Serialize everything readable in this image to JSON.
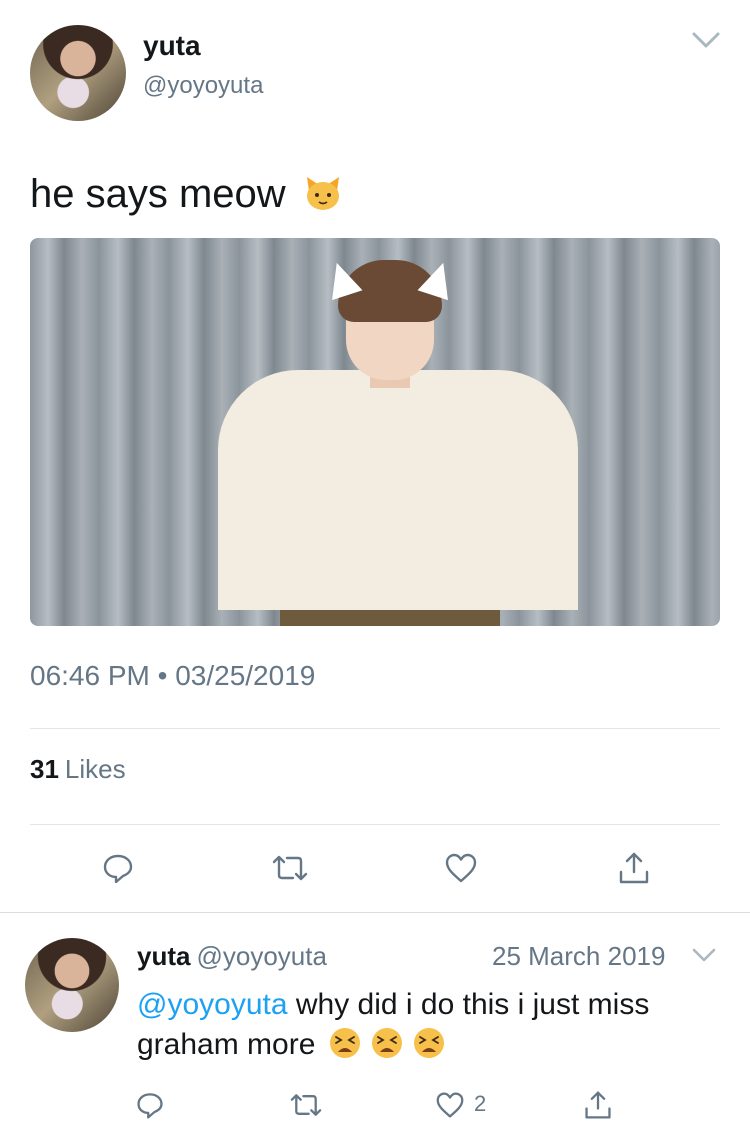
{
  "tweet": {
    "author_name": "yuta",
    "author_handle": "@yoyoyuta",
    "text": "he says meow",
    "emoji": "cat-face",
    "timestamp": "06:46 PM • 03/25/2019",
    "likes_count": "31",
    "likes_label": "Likes",
    "actions": [
      "reply-icon",
      "retweet-icon",
      "like-icon",
      "share-icon"
    ]
  },
  "reply": {
    "author_name": "yuta",
    "author_handle": "@yoyoyuta",
    "date": "25 March 2019",
    "mention": "@yoyoyuta",
    "text": " why did i do this i just miss graham more",
    "emojis": [
      "tired-face",
      "tired-face",
      "tired-face"
    ],
    "like_count": "2"
  },
  "colors": {
    "accent": "#1da1f2",
    "secondary_text": "#657786",
    "divider": "#e1e8ed"
  }
}
